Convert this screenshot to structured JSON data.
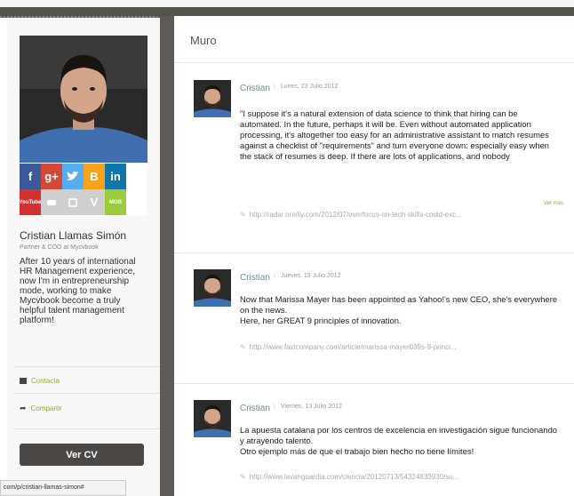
{
  "profile": {
    "name": "Cristian Llamas Simón",
    "role": "Partner & COO at Mycvbook",
    "bio": "After 10 years of international HR Management experience, now I'm in entrepreneurship mode, working to make Mycvbook become a truly helpful talent management platform!",
    "social": [
      "f",
      "g+",
      "t",
      "B",
      "in",
      "YouTube",
      "",
      "",
      "V",
      "MOB"
    ]
  },
  "links": {
    "contact": "Contacta",
    "share": "Compartir"
  },
  "cv_button": "Ver CV",
  "status_url": "com/p/cristian-llamas-simon#",
  "main": {
    "title": "Muro"
  },
  "posts": [
    {
      "author": "Cristian",
      "date": "Lunes, 23 Julio 2012",
      "text": "\"I suppose it's a natural extension of data science to think that hiring can be automated. In the future, perhaps it will be. Even without automated application processing, it's altogether too easy for an administrative assistant to match resumes against a checklist of \"requirements\" and turn everyone down: especially easy when the stack of resumes is deep. If there are lots of applications, and nobody",
      "more": "Ver más",
      "link": "http://radar.oreilly.com/2012/07/overfocus-on-tech-skills-could-exc..."
    },
    {
      "author": "Cristian",
      "date": "Jueves, 19 Julio 2012",
      "text": "Now that Marissa Mayer has been appointed as Yahoo!'s new CEO, she's everywhere on the news.\nHere, her GREAT 9 principles of innovation.",
      "link": "http://www.fastcompany.com/article/marissa-mayer039s-9-princi..."
    },
    {
      "author": "Cristian",
      "date": "Viernes, 13 Julio 2012",
      "text": "La apuesta catalana por los centros de excelencia en investigación sigue funcionando y atrayendo talento.\nOtro ejemplo más de que el trabajo bien hecho no tiene límites!",
      "link": "http://www.lavanguardia.com/ciencia/20120713/54324833930/su..."
    }
  ],
  "colors": {
    "accent_green": "#8fae2f",
    "dark": "#4a4745",
    "author_blue": "#6d8d9c"
  }
}
